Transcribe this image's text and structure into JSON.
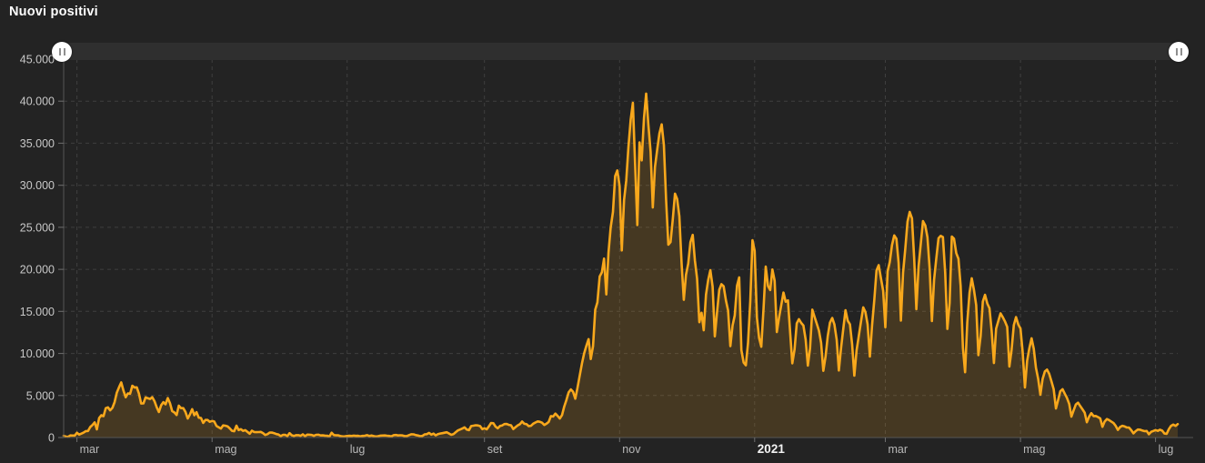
{
  "page": {
    "title": "Nuovi positivi"
  },
  "slider": {
    "handle_icon": "grip-vertical-icon"
  },
  "colors": {
    "background": "#232323",
    "line": "#f8a81c",
    "area_fill": "rgba(248,168,28,0.16)",
    "grid": "#3f3f3f",
    "axis": "#565656",
    "tick": "#6e6e6e",
    "x_label": "#b8b8b8",
    "y_label": "#c8c8c8",
    "year_label": "#f2f2f2",
    "slider_track": "#2f2f2f",
    "slider_handle": "#ffffff"
  },
  "chart_data": {
    "type": "area",
    "title": "Nuovi positivi",
    "legend": "none",
    "grid": "dashed",
    "ylim": [
      0,
      45000
    ],
    "y_tick_values": [
      0,
      5000,
      10000,
      15000,
      20000,
      25000,
      30000,
      35000,
      40000,
      45000
    ],
    "y_tick_labels": [
      "0",
      "5.000",
      "10.000",
      "15.000",
      "20.000",
      "25.000",
      "30.000",
      "35.000",
      "40.000",
      "45.000"
    ],
    "x_unit": "day",
    "x_ticks": [
      {
        "label": "mar",
        "index": 6,
        "bold": false
      },
      {
        "label": "mag",
        "index": 67,
        "bold": false
      },
      {
        "label": "lug",
        "index": 128,
        "bold": false
      },
      {
        "label": "set",
        "index": 190,
        "bold": false
      },
      {
        "label": "nov",
        "index": 251,
        "bold": false
      },
      {
        "label": "2021",
        "index": 312,
        "bold": true
      },
      {
        "label": "mar",
        "index": 371,
        "bold": false
      },
      {
        "label": "mag",
        "index": 432,
        "bold": false
      },
      {
        "label": "lug",
        "index": 493,
        "bold": false
      }
    ],
    "series": [
      {
        "name": "Nuovi positivi",
        "values": [
          221,
          93,
          78,
          250,
          238,
          240,
          566,
          342,
          466,
          587,
          769,
          778,
          1247,
          1492,
          1797,
          977,
          2313,
          2651,
          2547,
          3497,
          3590,
          3233,
          3526,
          4207,
          5322,
          5986,
          6557,
          5560,
          4789,
          5249,
          5210,
          6153,
          5959,
          5974,
          5217,
          4050,
          4053,
          4782,
          4668,
          4585,
          4805,
          4316,
          3599,
          3039,
          3836,
          4204,
          3951,
          4694,
          4092,
          3153,
          2972,
          2667,
          3786,
          3493,
          3491,
          3047,
          2256,
          2729,
          3370,
          2646,
          3021,
          2357,
          2324,
          1739,
          2091,
          2086,
          1872,
          1965,
          1900,
          1389,
          1221,
          1075,
          1444,
          1401,
          1327,
          1083,
          802,
          744,
          1402,
          888,
          992,
          789,
          875,
          675,
          451,
          813,
          665,
          642,
          652,
          669,
          531,
          300,
          397,
          584,
          593,
          516,
          416,
          355,
          178,
          318,
          321,
          177,
          518,
          270,
          197,
          280,
          283,
          202,
          379,
          163,
          346,
          338,
          301,
          210,
          329,
          331,
          251,
          264,
          224,
          221,
          113,
          577,
          296,
          255,
          259,
          174,
          126,
          142,
          182,
          201,
          187,
          223,
          192,
          208,
          138,
          193,
          214,
          276,
          188,
          234,
          169,
          114,
          162,
          230,
          233,
          249,
          219,
          190,
          128,
          282,
          306,
          252,
          275,
          254,
          170,
          181,
          289,
          386,
          379,
          295,
          239,
          159,
          190,
          384,
          402,
          552,
          347,
          463,
          259,
          412,
          481,
          523,
          574,
          629,
          479,
          320,
          403,
          642,
          845,
          947,
          1071,
          1210,
          953,
          878,
          1367,
          1411,
          1462,
          1444,
          1365,
          996,
          1108,
          978,
          1326,
          1733,
          1695,
          1297,
          1108,
          1370,
          1434,
          1597,
          1616,
          1501,
          1458,
          1008,
          1229,
          1452,
          1585,
          1907,
          1638,
          1587,
          1350,
          1392,
          1640,
          1786,
          1912,
          1869,
          1766,
          1494,
          1648,
          1851,
          2548,
          2499,
          2844,
          2578,
          2257,
          2677,
          3678,
          4458,
          5372,
          5724,
          5456,
          4619,
          5901,
          7332,
          8804,
          10010,
          10925,
          11705,
          9338,
          10874,
          15199,
          16079,
          19143,
          19644,
          21273,
          17012,
          21994,
          24991,
          26831,
          31084,
          31758,
          29907,
          22253,
          28244,
          30550,
          34505,
          37809,
          39811,
          32616,
          25271,
          35098,
          32961,
          37978,
          40902,
          37255,
          33979,
          27354,
          32191,
          34283,
          36176,
          37242,
          34767,
          28337,
          22930,
          23232,
          25853,
          29003,
          28352,
          26323,
          20648,
          16377,
          19350,
          20709,
          23225,
          24099,
          21052,
          18887,
          13720,
          14842,
          12756,
          16999,
          18727,
          19903,
          17938,
          12030,
          14844,
          17572,
          18236,
          17992,
          16308,
          15104,
          10872,
          13318,
          14522,
          18040,
          19037,
          10407,
          8913,
          8585,
          11212,
          16202,
          23477,
          22211,
          14245,
          11831,
          10800,
          15378,
          20331,
          18020,
          17533,
          19978,
          18627,
          12532,
          14242,
          15774,
          17246,
          16146,
          16310,
          12545,
          8824,
          10497,
          13571,
          14078,
          13633,
          13331,
          11629,
          8561,
          10593,
          15204,
          14372,
          13574,
          12715,
          11252,
          7925,
          9660,
          12074,
          13659,
          14218,
          13442,
          11641,
          7970,
          10630,
          12956,
          15146,
          13908,
          13452,
          11068,
          7351,
          10386,
          12074,
          13762,
          15479,
          14931,
          13452,
          9630,
          13314,
          16424,
          19886,
          20499,
          18916,
          17455,
          13114,
          19749,
          20884,
          22865,
          24036,
          23641,
          20765,
          13902,
          19611,
          22409,
          25673,
          26824,
          26062,
          21315,
          15267,
          20396,
          23059,
          25735,
          25222,
          23832,
          20159,
          13846,
          18765,
          21267,
          23696,
          23987,
          23839,
          19611,
          12916,
          16017,
          23904,
          23649,
          21932,
          21261,
          18025,
          10680,
          7767,
          13708,
          17221,
          18938,
          17567,
          15746,
          9789,
          12074,
          16168,
          16974,
          15943,
          15370,
          12694,
          8864,
          12950,
          13844,
          14761,
          14320,
          13817,
          13158,
          8444,
          10404,
          13385,
          14320,
          13446,
          12965,
          10176,
          5948,
          9116,
          10585,
          11807,
          10554,
          8292,
          6946,
          5080,
          6946,
          7852,
          8085,
          7567,
          6659,
          5753,
          3455,
          4452,
          5506,
          5741,
          5218,
          4717,
          3995,
          2490,
          3224,
          3937,
          4147,
          3738,
          3351,
          2949,
          1820,
          2483,
          2897,
          2557,
          2559,
          2436,
          2275,
          1273,
          1896,
          2199,
          2079,
          1901,
          1723,
          1390,
          907,
          1255,
          1400,
          1325,
          1197,
          1193,
          881,
          495,
          756,
          951,
          927,
          838,
          753,
          782,
          389,
          679,
          776,
          882,
          794,
          932,
          808,
          480,
          440,
          1010,
          1394,
          1534,
          1390,
          1597
        ]
      }
    ]
  }
}
